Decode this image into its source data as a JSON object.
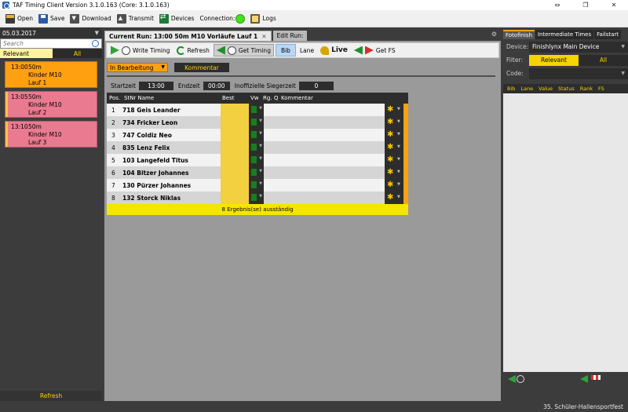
{
  "window": {
    "title": "TAF Timing Client Version 3.1.0.163 (Core: 3.1.0.163)",
    "minimize": "⇔",
    "restore": "❐",
    "close": "✕"
  },
  "toolbar": {
    "open": "Open",
    "save": "Save",
    "download": "Download",
    "transmit": "Transmit",
    "devices": "Devices",
    "connection": "Connection:",
    "connection_status_color": "#44e21b",
    "logs": "Logs"
  },
  "left": {
    "date": "05.03.2017",
    "search_placeholder": "Search",
    "filter_relevant": "Relevant",
    "filter_all": "All",
    "runs": [
      {
        "time": "13:00",
        "dist": "50m",
        "group": "Kinder M10",
        "lauf": "Lauf 1",
        "selected": true
      },
      {
        "time": "13:05",
        "dist": "50m",
        "group": "Kinder M10",
        "lauf": "Lauf 2",
        "selected": false
      },
      {
        "time": "13:10",
        "dist": "50m",
        "group": "Kinder M10",
        "lauf": "Lauf 3",
        "selected": false
      }
    ],
    "refresh": "Refresh"
  },
  "center": {
    "tab_current": "Current Run: 13:00 50m  M10 Vorläufe Lauf 1",
    "tab_close": "✕",
    "tab_edit": "Edit Run:",
    "actions": {
      "write_timing": "Write Timing",
      "refresh": "Refresh",
      "get_timing": "Get Timing",
      "bib": "Bib",
      "lane": "Lane",
      "live": "Live",
      "get_fs": "Get FS"
    },
    "status": "In Bearbeitung",
    "kommentar": "Kommentar",
    "startzeit_label": "Startzeit",
    "startzeit": "13:00",
    "endzeit_label": "Endzeit",
    "endzeit": "00:00",
    "inoff_label": "Inoffizielle Siegerzeit",
    "inoff_value": "0",
    "columns": {
      "pos": "Pos.",
      "stnr_name": "StNr Name",
      "best": "Best",
      "vw": "Vw",
      "rg": "Rg.",
      "q": "Q",
      "kommentar": "Kommentar"
    },
    "rows": [
      {
        "pos": "1",
        "name": "718 Geis Leander"
      },
      {
        "pos": "2",
        "name": "734 Fricker Leon"
      },
      {
        "pos": "3",
        "name": "747 Coldiz Neo"
      },
      {
        "pos": "4",
        "name": "835 Lenz Felix"
      },
      {
        "pos": "5",
        "name": "103 Langefeld Titus"
      },
      {
        "pos": "6",
        "name": "104 Bitzer Johannes"
      },
      {
        "pos": "7",
        "name": "130 Pürzer Johannes"
      },
      {
        "pos": "8",
        "name": "132 Storck Niklas"
      }
    ],
    "footer": "8 Ergebnis(se) ausständig"
  },
  "right": {
    "tabs": [
      "Fotofinish",
      "Intermediate Times",
      "Failstart"
    ],
    "device_label": "Device:",
    "device_value": "Finishlynx Main Device",
    "filter_label": "Filter:",
    "filter_relevant": "Relevant",
    "filter_all": "All",
    "code_label": "Code:",
    "columns": [
      "Bib",
      "Lane",
      "Value",
      "Status",
      "Rank",
      "FS"
    ]
  },
  "statusbar": {
    "event": "35. Schüler-Hallensportfest"
  }
}
